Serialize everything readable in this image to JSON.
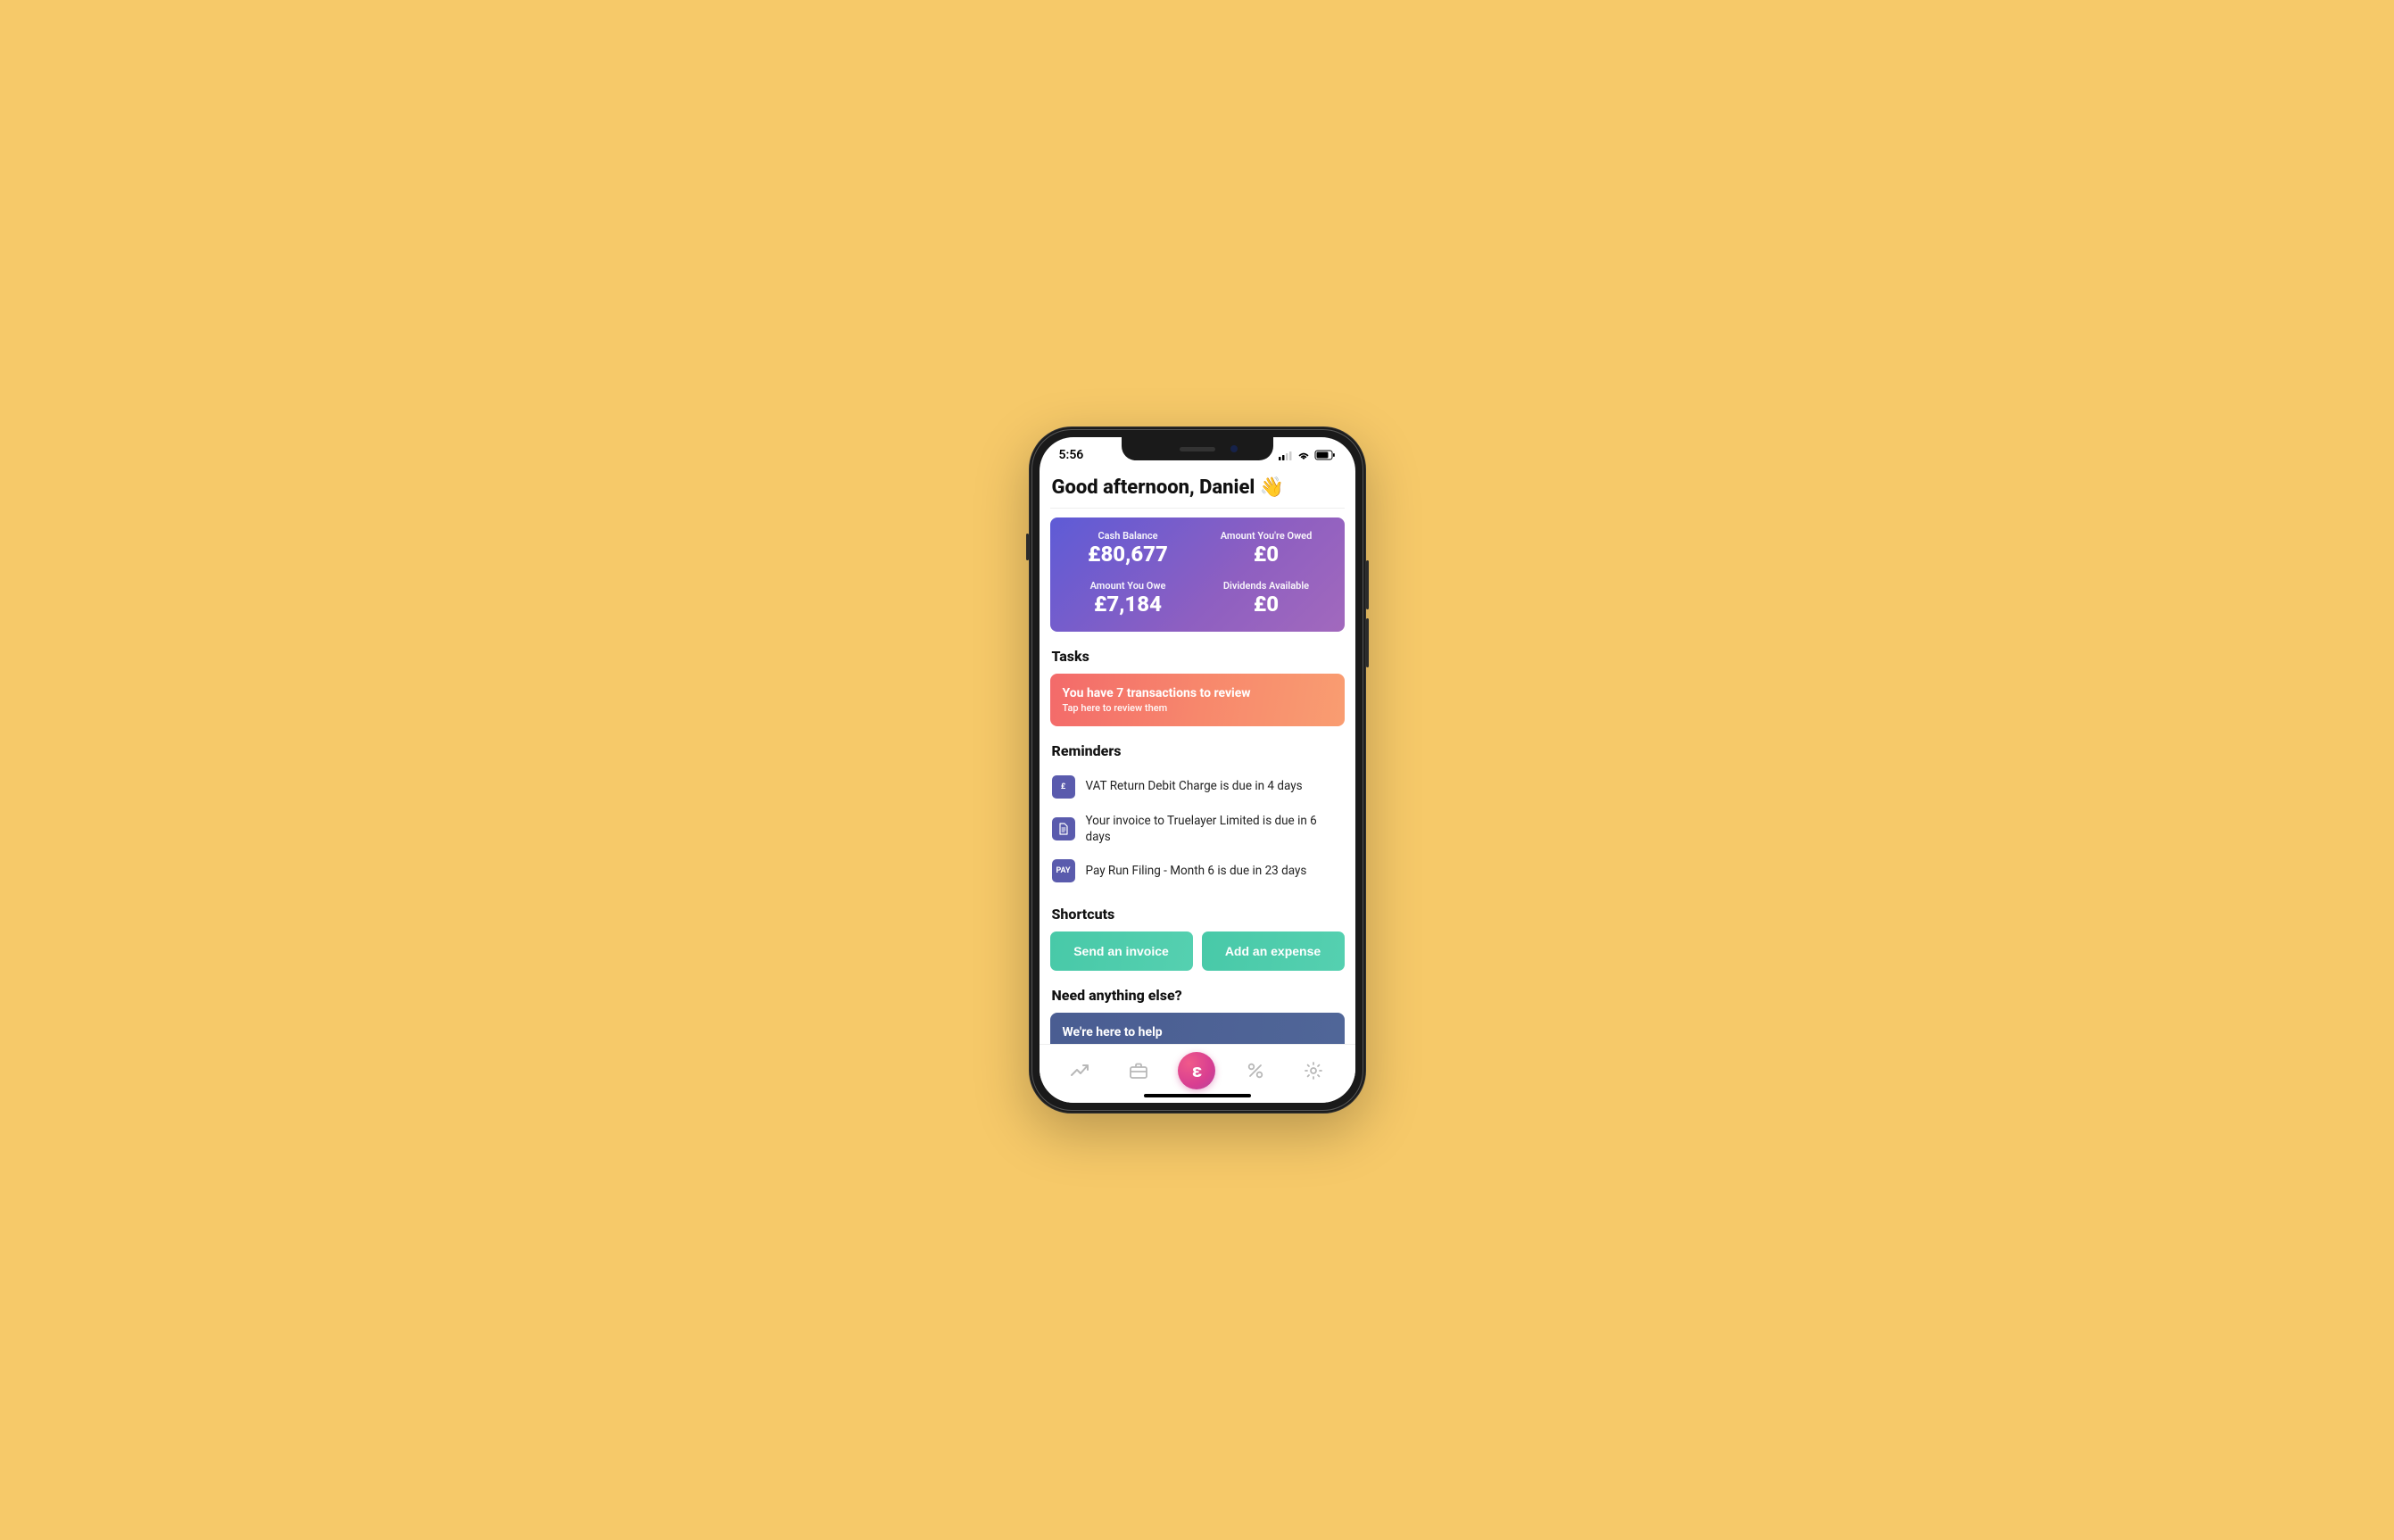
{
  "status": {
    "time": "5:56"
  },
  "greeting": "Good afternoon, Daniel 👋",
  "balance": {
    "cash_label": "Cash Balance",
    "cash_value": "£80,677",
    "owed_label": "Amount You're Owed",
    "owed_value": "£0",
    "owe_label": "Amount You Owe",
    "owe_value": "£7,184",
    "dividends_label": "Dividends Available",
    "dividends_value": "£0"
  },
  "sections": {
    "tasks": "Tasks",
    "reminders": "Reminders",
    "shortcuts": "Shortcuts",
    "help": "Need anything else?"
  },
  "task": {
    "title": "You have 7 transactions to review",
    "subtitle": "Tap here to review them"
  },
  "reminders": [
    {
      "icon": "£",
      "text": "VAT Return Debit Charge is due in 4 days"
    },
    {
      "icon": "doc",
      "text": "Your invoice to Truelayer Limited is due in 6 days"
    },
    {
      "icon": "PAY",
      "text": "Pay Run Filing - Month 6 is due in 23 days"
    }
  ],
  "shortcuts": {
    "invoice": "Send an invoice",
    "expense": "Add an expense"
  },
  "help_card": {
    "title": "We're here to help"
  },
  "nav": {
    "center_glyph": "ε"
  }
}
